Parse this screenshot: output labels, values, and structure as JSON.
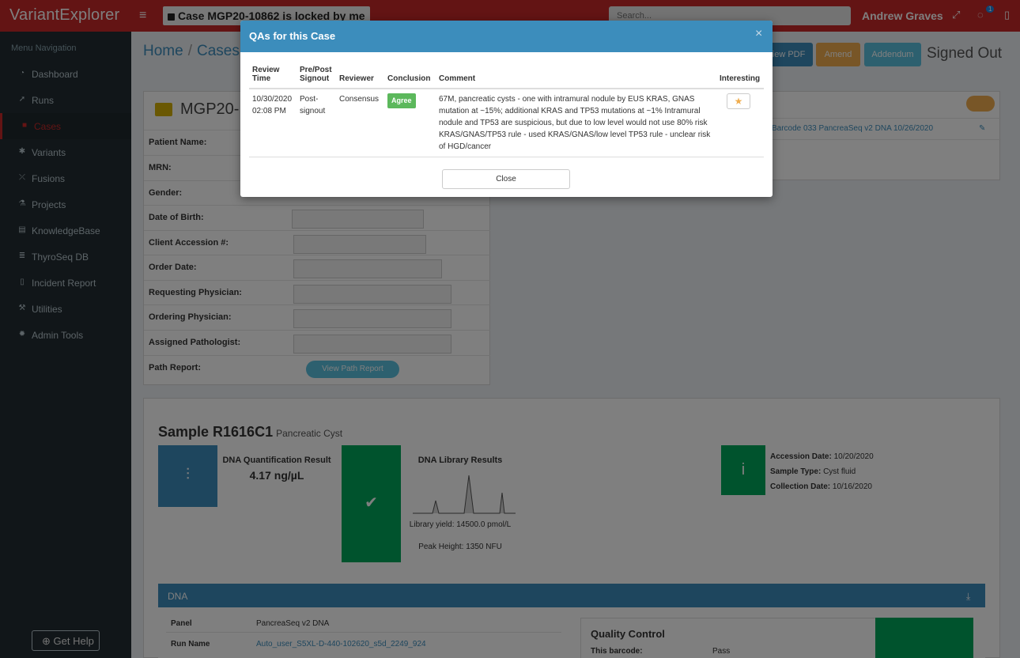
{
  "topbar": {
    "logo": "VariantExplorer",
    "lock_message": "Case MGP20-10862 is locked by me",
    "search_placeholder": "Search...",
    "username": "Andrew Graves",
    "notification_count": "1"
  },
  "sidebar": {
    "title": "Menu Navigation",
    "items": [
      {
        "label": "Dashboard",
        "icon": "dashboard-icon"
      },
      {
        "label": "Runs",
        "icon": "rocket-icon"
      },
      {
        "label": "Cases",
        "icon": "folder-icon"
      },
      {
        "label": "Variants",
        "icon": "asterisk-icon"
      },
      {
        "label": "Fusions",
        "icon": "fusion-icon"
      },
      {
        "label": "Projects",
        "icon": "flask-icon"
      },
      {
        "label": "KnowledgeBase",
        "icon": "book-icon"
      },
      {
        "label": "ThyroSeq DB",
        "icon": "database-icon"
      },
      {
        "label": "Incident Report",
        "icon": "file-icon"
      },
      {
        "label": "Utilities",
        "icon": "wrench-icon"
      },
      {
        "label": "Admin Tools",
        "icon": "gear-icon"
      }
    ],
    "active_item": "Cases",
    "help_label": "Get Help"
  },
  "breadcrumb": {
    "home": "Home",
    "cases": "Cases"
  },
  "actions": {
    "view_pdf": "View PDF",
    "amend": "Amend",
    "addendum": "Addendum",
    "status": "Signed Out"
  },
  "case": {
    "title": "MGP20-",
    "fields": [
      "Patient Name:",
      "MRN:",
      "Gender:",
      "Date of Birth:",
      "Client Accession #:",
      "Order Date:",
      "Requesting Physician:",
      "Ordering Physician:",
      "Assigned Pathologist:",
      "Path Report:"
    ],
    "path_report_button": "View Path Report"
  },
  "barcode_line": "Barcode 033 PancreaSeq v2 DNA 10/26/2020",
  "sample": {
    "title": "Sample R1616C1",
    "subtitle": "Pancreatic Cyst",
    "dna_quant": {
      "title": "DNA Quantification Result",
      "value": "4.17 ng/µL"
    },
    "library": {
      "title": "DNA Library Results",
      "yield": "Library yield: 14500.0 pmol/L",
      "peak": "Peak Height: 1350 NFU"
    },
    "accession": {
      "accession_label": "Accession Date:",
      "accession_value": "10/20/2020",
      "type_label": "Sample Type:",
      "type_value": "Cyst fluid",
      "collection_label": "Collection Date:",
      "collection_value": "10/16/2020"
    }
  },
  "dna": {
    "header": "DNA",
    "panel_label": "Panel",
    "panel_value": "PancreaSeq v2 DNA",
    "run_label": "Run Name",
    "run_value": "Auto_user_S5XL-D-440-102620_s5d_2249_924",
    "qc_title": "Quality Control",
    "qc_barcode_label": "This barcode:",
    "qc_barcode_value": "Pass"
  },
  "modal": {
    "title": "QAs for this Case",
    "headers": [
      "Review Time",
      "Pre/Post Signout",
      "Reviewer",
      "Conclusion",
      "Comment",
      "Interesting"
    ],
    "row": {
      "review_time": "10/30/2020 02:08 PM",
      "signout": "Post-signout",
      "reviewer": "Consensus",
      "conclusion": "Agree",
      "comment": "67M, pancreatic cysts - one with intramural nodule by EUS KRAS, GNAS mutation at ~15%; additional KRAS and TP53 mutations at ~1% Intramural nodule and TP53 are suspicious, but due to low level would not use 80% risk KRAS/GNAS/TP53 rule - used KRAS/GNAS/low level TP53 rule - unclear risk of HGD/cancer"
    },
    "close_label": "Close"
  }
}
